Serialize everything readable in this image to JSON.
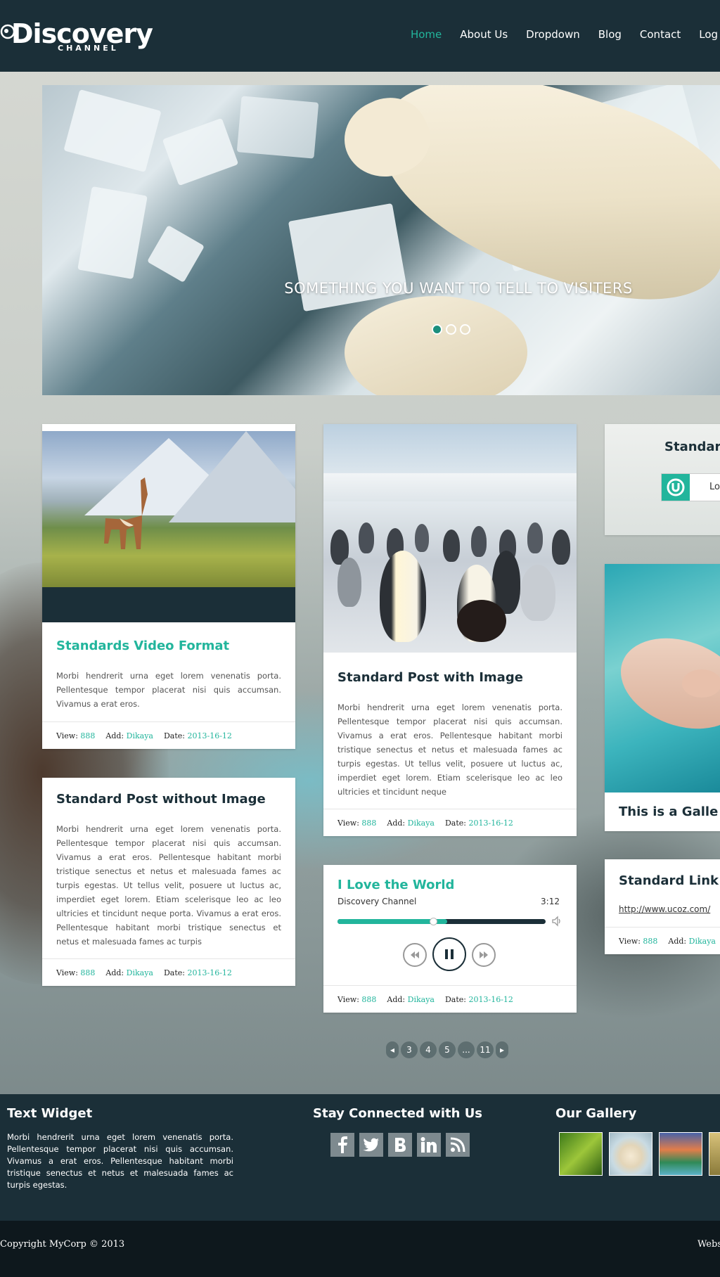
{
  "header": {
    "logo_text": "Discovery",
    "logo_sub": "CHANNEL",
    "nav": [
      "Home",
      "About Us",
      "Dropdown",
      "Blog",
      "Contact",
      "Log i"
    ]
  },
  "hero": {
    "caption": "SOMETHING YOU WANT TO TELL TO VISITERS",
    "active_dot": 1
  },
  "posts": {
    "video": {
      "title": "Standards Video Format",
      "text": "Morbi hendrerit urna eget lorem venenatis porta. Pellentesque tempor placerat nisi quis accumsan. Vivamus a erat eros.",
      "view": "888",
      "add": "Dikaya",
      "date": "2013-16-12"
    },
    "image": {
      "title": "Standard Post with Image",
      "text": "Morbi hendrerit urna eget lorem venenatis porta. Pellentesque tempor placerat nisi quis accumsan. Vivamus a erat eros. Pellentesque habitant morbi tristique senectus et netus et malesuada fames ac turpis egestas. Ut tellus velit, posuere ut luctus ac, imperdiet eget lorem. Etiam scelerisque leo ac leo ultricies et tincidunt neque",
      "view": "888",
      "add": "Dikaya",
      "date": "2013-16-12"
    },
    "noimage": {
      "title": "Standard Post without Image",
      "text": "Morbi hendrerit urna eget lorem venenatis porta. Pellentesque tempor placerat nisi quis accumsan. Vivamus a erat eros. Pellentesque habitant morbi tristique senectus et netus et malesuada fames ac turpis egestas. Ut tellus velit, posuere ut luctus ac, imperdiet eget lorem. Etiam scelerisque leo ac leo ultricies et tincidunt neque porta. Vivamus a erat eros. Pellentesque habitant morbi tristique senectus et netus et malesuada fames ac turpis",
      "view": "888",
      "add": "Dikaya",
      "date": "2013-16-12"
    },
    "audio": {
      "title": "I Love the World",
      "artist": "Discovery Channel",
      "duration": "3:12",
      "progress": 0.46,
      "view": "888",
      "add": "Dikaya",
      "date": "2013-16-12"
    },
    "login": {
      "title": "Standar",
      "button_label": "Lo"
    },
    "gallery": {
      "title": "This is a Galle"
    },
    "link": {
      "title": "Standard Link",
      "url": "http://www.ucoz.com/",
      "view": "888",
      "add": "Dikaya"
    }
  },
  "meta_labels": {
    "view": "View:",
    "add": "Add:",
    "date": "Date:"
  },
  "pagination": {
    "prev": "◂",
    "pages": [
      "3",
      "4",
      "5",
      "...",
      "11"
    ],
    "next": "▸"
  },
  "footer": {
    "text_widget": {
      "title": "Text Widget",
      "text": "Morbi hendrerit urna eget lorem venenatis porta. Pellentesque tempor placerat nisi quis accumsan. Vivamus a erat eros. Pellentesque habitant morbi tristique senectus et netus et malesuada fames ac turpis egestas."
    },
    "social": {
      "title": "Stay Connected with Us",
      "icons": [
        "facebook-icon",
        "twitter-icon",
        "blogger-icon",
        "linkedin-icon",
        "rss-icon"
      ]
    },
    "gallery_title": "Our Gallery",
    "copyright": "Copyright MyCorp © 2013",
    "right_text": "Webs"
  },
  "colors": {
    "accent": "#22b59c",
    "dark": "#1b2f38",
    "darker": "#0e181d"
  }
}
